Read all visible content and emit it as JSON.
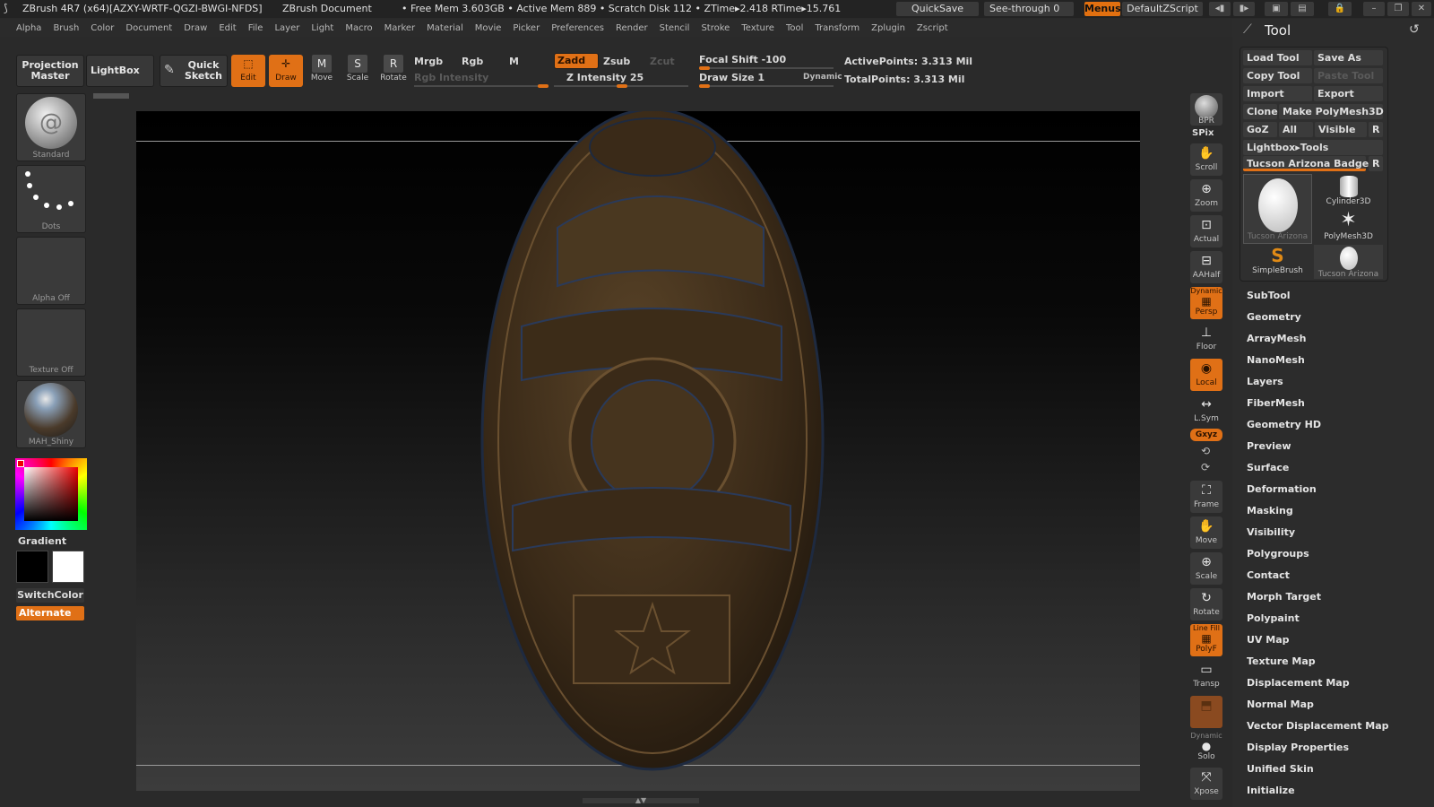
{
  "titlebar": {
    "app": "ZBrush 4R7 (x64)[AZXY-WRTF-QGZI-BWGI-NFDS]",
    "doc": "ZBrush Document",
    "stats": "• Free Mem 3.603GB • Active Mem 889 • Scratch Disk 112 • ZTime▸2.418 RTime▸15.761",
    "quicksave": "QuickSave",
    "seethrough": "See-through   0",
    "menus": "Menus",
    "script": "DefaultZScript"
  },
  "menubar": [
    "Alpha",
    "Brush",
    "Color",
    "Document",
    "Draw",
    "Edit",
    "File",
    "Layer",
    "Light",
    "Macro",
    "Marker",
    "Material",
    "Movie",
    "Picker",
    "Preferences",
    "Render",
    "Stencil",
    "Stroke",
    "Texture",
    "Tool",
    "Transform",
    "Zplugin",
    "Zscript"
  ],
  "shelf": {
    "projection_master": "Projection Master",
    "lightbox": "LightBox",
    "quick_sketch": "Quick Sketch",
    "edit": "Edit",
    "draw": "Draw",
    "move": "Move",
    "scale": "Scale",
    "rotate": "Rotate",
    "mrgb": "Mrgb",
    "rgb": "Rgb",
    "m": "M",
    "zadd": "Zadd",
    "zsub": "Zsub",
    "zcut": "Zcut",
    "rgb_intensity": "Rgb Intensity",
    "z_intensity": "Z Intensity 25",
    "focal_shift": "Focal Shift -100",
    "draw_size": "Draw Size 1",
    "dynamic": "Dynamic",
    "active_points": "ActivePoints: 3.313  Mil",
    "total_points": "TotalPoints: 3.313  Mil"
  },
  "lefttray": {
    "standard": "Standard",
    "dots": "Dots",
    "alpha_off": "Alpha  Off",
    "texture_off": "Texture  Off",
    "material": "MAH_Shiny",
    "gradient": "Gradient",
    "switchcolor": "SwitchColor",
    "alternate": "Alternate"
  },
  "righttray": {
    "bpr": "BPR",
    "spix": "SPix",
    "scroll": "Scroll",
    "zoom": "Zoom",
    "actual": "Actual",
    "aahalf": "AAHalf",
    "persp_top": "Dynamic",
    "persp": "Persp",
    "floor": "Floor",
    "local": "Local",
    "lsym": "L.Sym",
    "xyz": "Gxyz",
    "frame": "Frame",
    "move": "Move",
    "scale": "Scale",
    "rotate": "Rotate",
    "polyf_top": "Line Fill",
    "polyf": "PolyF",
    "transp": "Transp",
    "solo_top": "Dynamic",
    "solo": "Solo",
    "xpose": "Xpose"
  },
  "toolpanel": {
    "title": "Tool",
    "load_tool": "Load Tool",
    "save_as": "Save As",
    "copy_tool": "Copy Tool",
    "paste_tool": "Paste Tool",
    "import": "Import",
    "export": "Export",
    "clone": "Clone",
    "make_polymesh": "Make PolyMesh3D",
    "goz": "GoZ",
    "all": "All",
    "visible": "Visible",
    "r": "R",
    "lightbox_tools": "Lightbox▸Tools",
    "current_tool": "Tucson Arizona Badge",
    "thumb1": "Tucson  Arizona",
    "thumb2": "Cylinder3D",
    "thumb3": "PolyMesh3D",
    "thumb4": "SimpleBrush",
    "thumb5": "Tucson  Arizona",
    "list": [
      "SubTool",
      "Geometry",
      "ArrayMesh",
      "NanoMesh",
      "Layers",
      "FiberMesh",
      "Geometry HD",
      "Preview",
      "Surface",
      "Deformation",
      "Masking",
      "Visibility",
      "Polygroups",
      "Contact",
      "Morph Target",
      "Polypaint",
      "UV Map",
      "Texture Map",
      "Displacement Map",
      "Normal Map",
      "Vector Displacement Map",
      "Display Properties",
      "Unified Skin",
      "Initialize"
    ]
  }
}
